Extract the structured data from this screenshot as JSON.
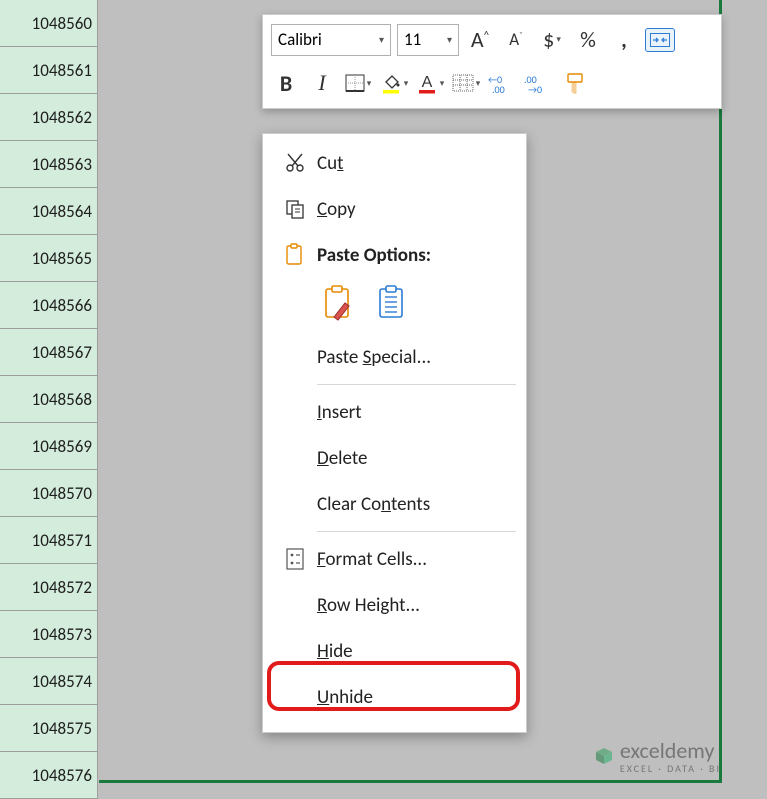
{
  "rows": [
    "1048560",
    "1048561",
    "1048562",
    "1048563",
    "1048564",
    "1048565",
    "1048566",
    "1048567",
    "1048568",
    "1048569",
    "1048570",
    "1048571",
    "1048572",
    "1048573",
    "1048574",
    "1048575",
    "1048576"
  ],
  "miniToolbar": {
    "fontName": "Calibri",
    "fontSize": "11"
  },
  "contextMenu": {
    "cut": "Cut",
    "copy": "Copy",
    "pasteOptions": "Paste Options:",
    "pasteSpecial": "Paste Special...",
    "insert": "Insert",
    "delete": "Delete",
    "clearContents": "Clear Contents",
    "formatCells": "Format Cells...",
    "rowHeight": "Row Height...",
    "hide": "Hide",
    "unhide": "Unhide"
  },
  "watermark": {
    "brand": "exceldemy",
    "tag": "EXCEL · DATA · BI"
  }
}
